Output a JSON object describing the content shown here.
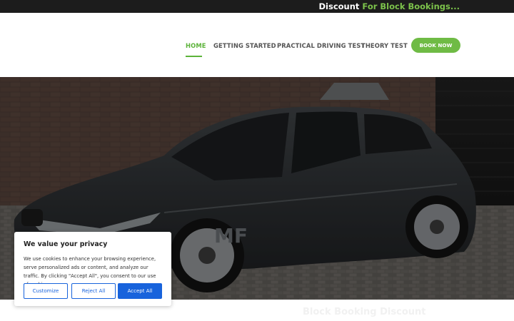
{
  "topbar": {
    "discount_word": "Discount",
    "discount_rest": " For Block Bookings..."
  },
  "nav": {
    "items": [
      {
        "label": "HOME",
        "active": true
      },
      {
        "label": "GETTING STARTED",
        "active": false
      },
      {
        "label": "PRACTICAL DRIVING TEST",
        "active": false
      },
      {
        "label": "THEORY TEST",
        "active": false
      }
    ],
    "book_now": "BOOK NOW"
  },
  "hero": {
    "car_plate_fragment": "MF",
    "below_text": "Block Booking Discount"
  },
  "cookie_banner": {
    "title": "We value your privacy",
    "body": "We use cookies to enhance your browsing experience, serve personalized ads or content, and analyze our traffic. By clicking \"Accept All\", you consent to our use of cookies.",
    "buttons": {
      "customize": "Customize",
      "reject": "Reject All",
      "accept": "Accept All"
    }
  },
  "colors": {
    "accent_green": "#6fbb45",
    "topbar_bg": "#1c1c1c",
    "cookie_blue": "#1863dc"
  }
}
